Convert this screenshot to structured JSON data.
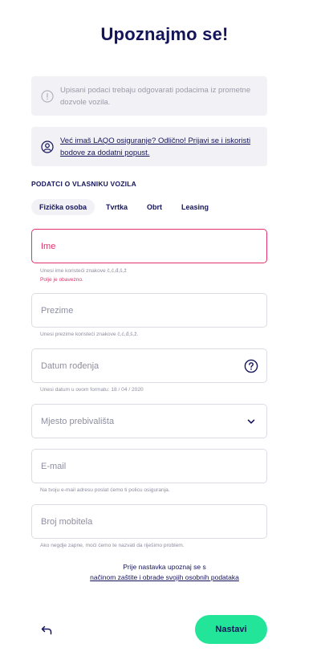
{
  "title": "Upoznajmo se!",
  "info_card": {
    "icon": "info-icon",
    "text": "Upisani podaci trebaju odgovarati podacima iz prometne dozvole vozila."
  },
  "promo_card": {
    "icon": "user-icon",
    "text": "Već imaš LAQO osiguranje? Odlično! Prijavi se i iskoristi bodove za dodatni popust."
  },
  "section_label": "PODATCI O VLASNIKU VOZILA",
  "tabs": [
    {
      "label": "Fizička osoba",
      "active": true
    },
    {
      "label": "Tvrtka",
      "active": false
    },
    {
      "label": "Obrt",
      "active": false
    },
    {
      "label": "Leasing",
      "active": false
    }
  ],
  "fields": {
    "ime": {
      "placeholder": "Ime",
      "hint": "Unesi ime koristeći znakove č,ć,đ,š,ž",
      "error": "Polje je obavezno."
    },
    "prezime": {
      "placeholder": "Prezime",
      "hint": "Unesi prezime koristeći znakove č,ć,đ,š,ž."
    },
    "datum": {
      "placeholder": "Datum rođenja",
      "hint": "Unesi datum u ovom formatu: 18 / 04 / 2020",
      "icon": "help-circle-icon"
    },
    "mjesto": {
      "placeholder": "Mjesto prebivališta",
      "icon": "chevron-down-icon"
    },
    "email": {
      "placeholder": "E-mail",
      "hint": "Na tvoju e-mail adresu poslat ćemo ti policu osiguranja."
    },
    "mobitel": {
      "placeholder": "Broj mobitela",
      "hint": "Ako negdje zapne, moći ćemo te nazvati da riješimo problem."
    }
  },
  "consent": {
    "text": "Prije nastavka upoznaj se s",
    "link": "načinom zaštite i obrade svojih osobnih podataka"
  },
  "footer": {
    "back_icon": "back-arrow-icon",
    "next_label": "Nastavi"
  },
  "colors": {
    "primary": "#14145a",
    "accent": "#22e59a",
    "error": "#e0336a"
  }
}
